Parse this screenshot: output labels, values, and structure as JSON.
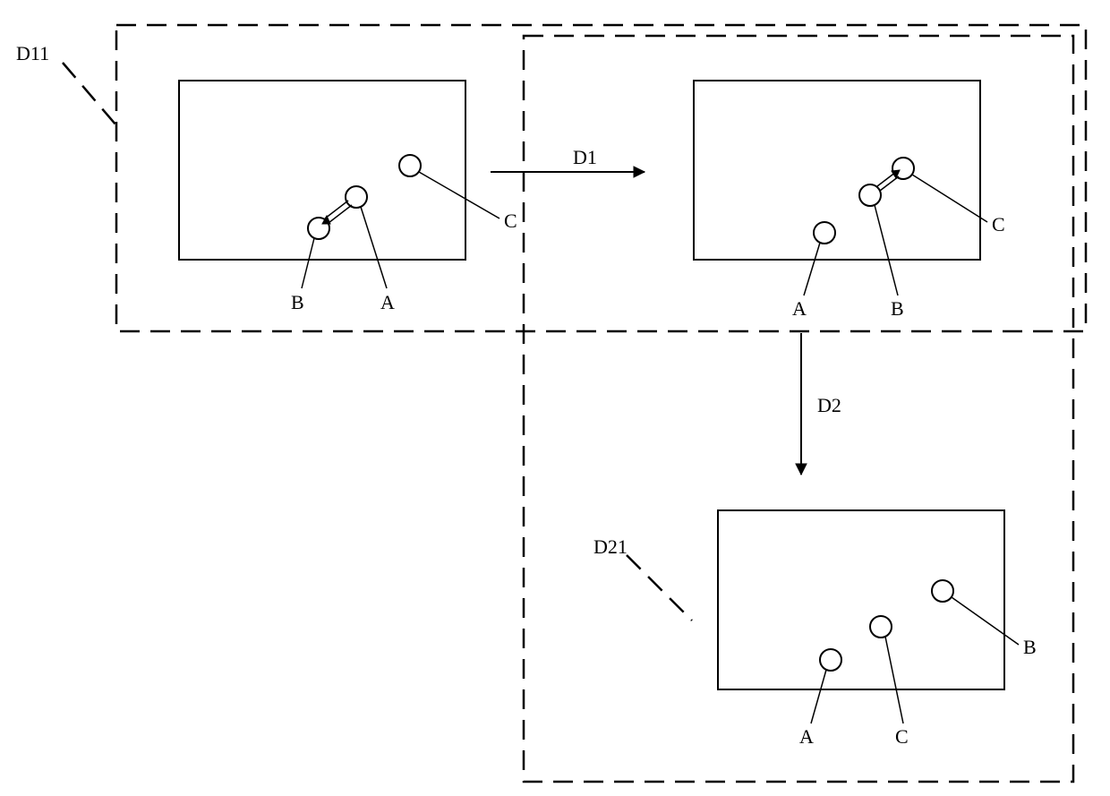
{
  "region_labels": {
    "top": "D11",
    "bottom": "D21"
  },
  "arrow_labels": {
    "horizontal": "D1",
    "vertical": "D2"
  },
  "frame_top_left": {
    "points": {
      "lower_left": "B",
      "mid": "A",
      "upper_right": "C"
    }
  },
  "frame_top_right": {
    "points": {
      "lower_left": "A",
      "mid": "B",
      "upper_right": "C"
    }
  },
  "frame_bottom": {
    "points": {
      "lower_left": "A",
      "mid": "C",
      "upper_right": "B"
    }
  },
  "chart_data": {
    "type": "diagram",
    "description": "State-transition schematic with three framed panels containing labeled points A, B, C. Panel transitions D1 (left→right) and D2 (right→down) relabel/move the points. Dashed regions D11 encloses the top two panels; D21 encloses the right-top and bottom panels.",
    "panels": [
      {
        "id": "top-left",
        "labels_order_lowerleft_to_upperright": [
          "B",
          "A",
          "C"
        ]
      },
      {
        "id": "top-right",
        "labels_order_lowerleft_to_upperright": [
          "A",
          "B",
          "C"
        ]
      },
      {
        "id": "bottom",
        "labels_order_lowerleft_to_upperright": [
          "A",
          "C",
          "B"
        ]
      }
    ],
    "transitions": [
      {
        "from": "top-left",
        "to": "top-right",
        "label": "D1"
      },
      {
        "from": "top-right",
        "to": "bottom",
        "label": "D2"
      }
    ],
    "regions": [
      {
        "name": "D11",
        "contains": [
          "top-left",
          "top-right"
        ]
      },
      {
        "name": "D21",
        "contains": [
          "top-right",
          "bottom"
        ]
      }
    ]
  }
}
